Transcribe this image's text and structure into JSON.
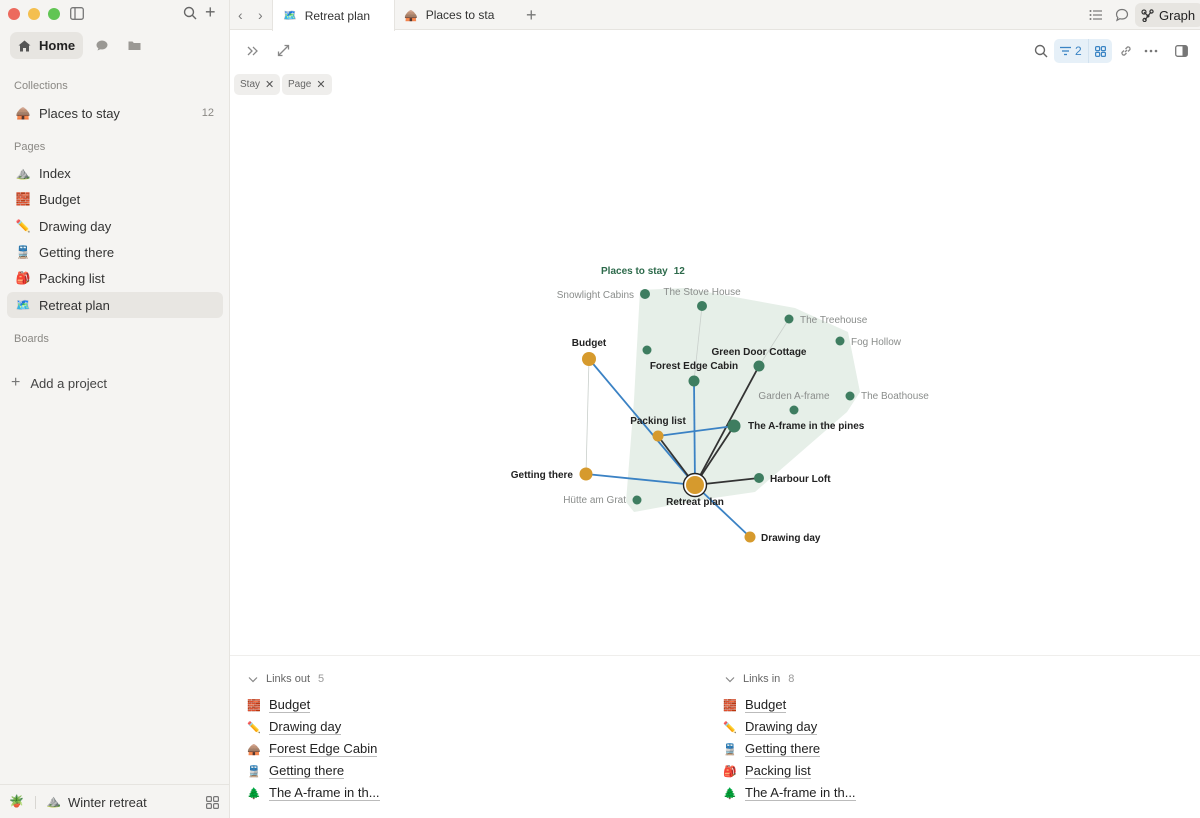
{
  "sidebar": {
    "nav": {
      "home_label": "Home"
    },
    "collections_label": "Collections",
    "collections": [
      {
        "emoji": "🛖",
        "label": "Places to stay",
        "count": "12"
      }
    ],
    "pages_label": "Pages",
    "pages": [
      {
        "emoji": "⛰️",
        "label": "Index"
      },
      {
        "emoji": "🧱",
        "label": "Budget"
      },
      {
        "emoji": "✏️",
        "label": "Drawing day"
      },
      {
        "emoji": "🚆",
        "label": "Getting there"
      },
      {
        "emoji": "🎒",
        "label": "Packing list"
      },
      {
        "emoji": "🗺️",
        "label": "Retreat plan"
      }
    ],
    "boards_label": "Boards",
    "add_project_label": "Add a project",
    "footer": {
      "plant_emoji": "🪴",
      "workspace_emoji": "⛰️",
      "workspace_name": "Winter retreat"
    }
  },
  "tabs": [
    {
      "emoji": "🗺️",
      "label": "Retreat plan"
    },
    {
      "emoji": "🛖",
      "label": "Places to sta"
    }
  ],
  "topbar": {
    "graph_label": "Graph"
  },
  "toolbar": {
    "filter_count": "2"
  },
  "filter_chips": [
    {
      "label": "Stay"
    },
    {
      "label": "Page"
    }
  ],
  "graph": {
    "cluster": {
      "label": "Places to stay",
      "count": "12"
    },
    "colors": {
      "stay": "#3e7d60",
      "page": "#d69a2d",
      "hull": "#e6efe8",
      "edge_blue": "#3b82c4",
      "edge_dark": "#333333",
      "edge_faint": "#c9cfcb"
    },
    "nodes": [
      {
        "id": "retreat",
        "label": "Retreat plan",
        "kind": "center"
      },
      {
        "id": "budget",
        "label": "Budget",
        "kind": "page"
      },
      {
        "id": "packing",
        "label": "Packing list",
        "kind": "page"
      },
      {
        "id": "getting",
        "label": "Getting there",
        "kind": "page"
      },
      {
        "id": "drawing",
        "label": "Drawing day",
        "kind": "page"
      },
      {
        "id": "snowlight",
        "label": "Snowlight Cabins",
        "kind": "stay-faint"
      },
      {
        "id": "stove",
        "label": "The Stove House",
        "kind": "stay-faint"
      },
      {
        "id": "treehouse",
        "label": "The Treehouse",
        "kind": "stay-faint"
      },
      {
        "id": "fog",
        "label": "Fog Hollow",
        "kind": "stay-faint"
      },
      {
        "id": "unnamed",
        "label": "",
        "kind": "stay-faint"
      },
      {
        "id": "greendoor",
        "label": "Green Door Cottage",
        "kind": "stay"
      },
      {
        "id": "forestedge",
        "label": "Forest Edge Cabin",
        "kind": "stay"
      },
      {
        "id": "garden",
        "label": "Garden A-frame",
        "kind": "stay-faint"
      },
      {
        "id": "boathouse",
        "label": "The Boathouse",
        "kind": "stay-faint"
      },
      {
        "id": "aframe",
        "label": "The A-frame in the pines",
        "kind": "stay"
      },
      {
        "id": "harbour",
        "label": "Harbour Loft",
        "kind": "stay"
      },
      {
        "id": "hutte",
        "label": "Hütte am Grat",
        "kind": "stay-faint"
      }
    ],
    "edges": [
      {
        "from": "retreat",
        "to": "budget",
        "style": "blue"
      },
      {
        "from": "retreat",
        "to": "packing",
        "style": "dark"
      },
      {
        "from": "retreat",
        "to": "getting",
        "style": "blue"
      },
      {
        "from": "retreat",
        "to": "drawing",
        "style": "blue"
      },
      {
        "from": "retreat",
        "to": "forestedge",
        "style": "blue"
      },
      {
        "from": "retreat",
        "to": "greendoor",
        "style": "dark"
      },
      {
        "from": "retreat",
        "to": "aframe",
        "style": "dark"
      },
      {
        "from": "retreat",
        "to": "harbour",
        "style": "dark"
      },
      {
        "from": "packing",
        "to": "aframe",
        "style": "blue"
      },
      {
        "from": "budget",
        "to": "getting",
        "style": "faint"
      },
      {
        "from": "forestedge",
        "to": "stove",
        "style": "faint"
      },
      {
        "from": "greendoor",
        "to": "treehouse",
        "style": "faint"
      }
    ]
  },
  "links_out": {
    "label": "Links out",
    "count": "5",
    "items": [
      {
        "emoji": "🧱",
        "label": "Budget"
      },
      {
        "emoji": "✏️",
        "label": "Drawing day"
      },
      {
        "emoji": "🛖",
        "label": "Forest Edge Cabin"
      },
      {
        "emoji": "🚆",
        "label": "Getting there"
      },
      {
        "emoji": "🌲",
        "label": "The A-frame in th..."
      }
    ]
  },
  "links_in": {
    "label": "Links in",
    "count": "8",
    "items": [
      {
        "emoji": "🧱",
        "label": "Budget"
      },
      {
        "emoji": "✏️",
        "label": "Drawing day"
      },
      {
        "emoji": "🚆",
        "label": "Getting there"
      },
      {
        "emoji": "🎒",
        "label": "Packing list"
      },
      {
        "emoji": "🌲",
        "label": "The A-frame in th..."
      }
    ]
  }
}
